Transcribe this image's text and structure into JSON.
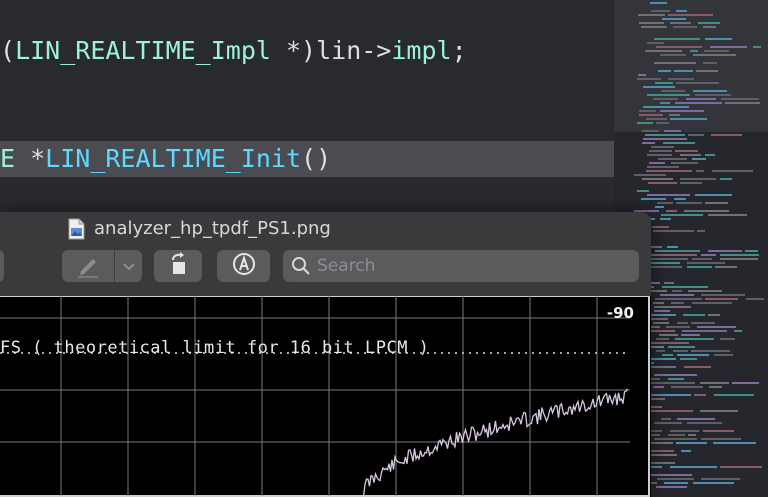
{
  "editor": {
    "line1": {
      "open_paren": "(",
      "type": "LIN_REALTIME_Impl",
      "mid": " *)lin->",
      "member": "impl",
      "end": ";"
    },
    "line2": {
      "type_tail": "E",
      "mid": " *",
      "func": "LIN_REALTIME_Init",
      "end": "()"
    }
  },
  "viewer": {
    "title": "analyzer_hp_tpdf_PS1.png",
    "icon_name": "png-file-icon",
    "toolbar": {
      "markup_icon": "pen-icon",
      "markup_menu_icon": "chevron-down-icon",
      "rotate_icon": "rotate-left-icon",
      "annotate_icon": "markup-circle-icon",
      "search_icon": "search-icon",
      "search_placeholder": "Search"
    },
    "plot": {
      "label": "FS ( theoretical limit for 16 bit LPCM )",
      "tick_label": "-90"
    }
  },
  "colors": {
    "editor_bg": "#292a30",
    "highlight_line": "#4b4c52",
    "type_color": "#9ef1dd",
    "function_color": "#5dd8ff",
    "plain_color": "#dfdfe0",
    "noise_trace": "#d8c8e0"
  }
}
